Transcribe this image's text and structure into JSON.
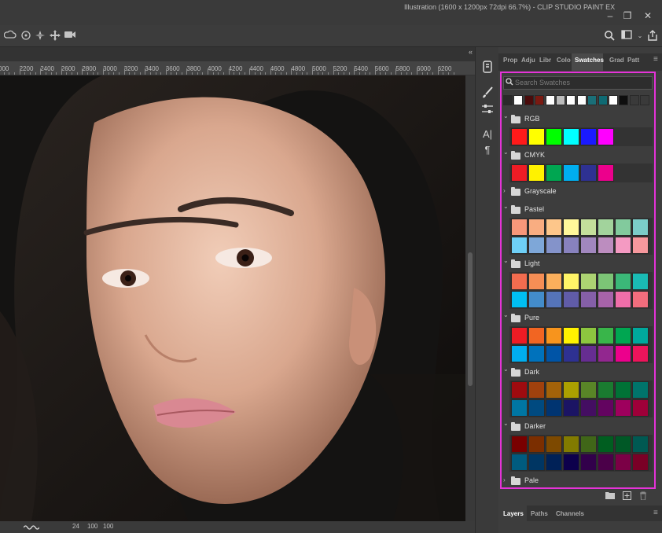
{
  "window": {
    "title": "Illustration (1600 x 1200px 72dpi 66.7%) - CLIP STUDIO PAINT EX",
    "minimize": "–",
    "restore": "❐",
    "close": "✕"
  },
  "ruler": {
    "labels": [
      "000",
      "2200",
      "2400",
      "2600",
      "2800",
      "3000",
      "3200",
      "3400",
      "3600",
      "3800",
      "4000",
      "4200",
      "4400",
      "4600",
      "4800",
      "5000",
      "5200",
      "5400",
      "5600",
      "5800",
      "6000",
      "6200"
    ]
  },
  "status": {
    "brush_size": "24",
    "zoom1": "100",
    "zoom2": "100"
  },
  "panel_tabs": {
    "tabs": [
      "Prop",
      "Adju",
      "Libr",
      "Colo",
      "Swatches",
      "Grad",
      "Patt"
    ],
    "active": "Swatches"
  },
  "swatches": {
    "search_placeholder": "Search Swatches",
    "recent_colors": [
      "#2a2a2a",
      "#ffffff",
      "#4a0b0b",
      "#7a1a12",
      "#ffffff",
      "#bcbcbc",
      "#ffffff",
      "#ffffff",
      "#1a6f78",
      "#0f6a73",
      "#ffffff",
      "#0e0e0e",
      "#3a3a3a",
      "#3a3a3a"
    ],
    "groups": [
      {
        "name": "RGB",
        "expanded": true,
        "rows": [
          [
            "#ff1a1a",
            "#ffff00",
            "#00ff00",
            "#00ffff",
            "#1a1aff",
            "#ff00ff"
          ]
        ]
      },
      {
        "name": "CMYK",
        "expanded": true,
        "rows": [
          [
            "#ee1c25",
            "#fff200",
            "#00a651",
            "#00aeef",
            "#2e3192",
            "#ec008c"
          ]
        ]
      },
      {
        "name": "Grayscale",
        "expanded": false,
        "rows": []
      },
      {
        "name": "Pastel",
        "expanded": true,
        "rows": [
          [
            "#f7977a",
            "#f9ad81",
            "#fdc68a",
            "#fff79a",
            "#c4df9b",
            "#a2d39c",
            "#82ca9d",
            "#7bcdc8"
          ],
          [
            "#6ecff6",
            "#7ea7d8",
            "#8493ca",
            "#8882be",
            "#a187be",
            "#bc8dbf",
            "#f49ac2",
            "#f6989d"
          ]
        ]
      },
      {
        "name": "Light",
        "expanded": true,
        "rows": [
          [
            "#f26c4f",
            "#f68e55",
            "#fbaf5c",
            "#fff467",
            "#acd372",
            "#7cc576",
            "#3bb878",
            "#1abbb4"
          ],
          [
            "#00bff3",
            "#438ccb",
            "#5574b9",
            "#605ca8",
            "#855fa8",
            "#a763a9",
            "#f06ea9",
            "#f26d7d"
          ]
        ]
      },
      {
        "name": "Pure",
        "expanded": true,
        "rows": [
          [
            "#ed1c24",
            "#f26522",
            "#f7941d",
            "#fff200",
            "#8dc63f",
            "#39b54a",
            "#00a651",
            "#00a99d"
          ],
          [
            "#00aeef",
            "#0072bc",
            "#0054a6",
            "#2e3192",
            "#662d91",
            "#92278f",
            "#ec008c",
            "#ed145b"
          ]
        ]
      },
      {
        "name": "Dark",
        "expanded": true,
        "rows": [
          [
            "#9e0b0f",
            "#a0410d",
            "#a36209",
            "#aba000",
            "#598527",
            "#1a7b30",
            "#007236",
            "#00746b"
          ],
          [
            "#0076a3",
            "#004a80",
            "#003471",
            "#1b1464",
            "#440e62",
            "#630460",
            "#9e005d",
            "#9e0039"
          ]
        ]
      },
      {
        "name": "Darker",
        "expanded": true,
        "rows": [
          [
            "#790000",
            "#7b2e00",
            "#7d4900",
            "#827b00",
            "#406618",
            "#005e20",
            "#005826",
            "#005952"
          ],
          [
            "#005b7f",
            "#003663",
            "#002157",
            "#0d004c",
            "#32004b",
            "#4b0049",
            "#7b0046",
            "#7a0026"
          ]
        ]
      },
      {
        "name": "Pale",
        "expanded": false,
        "rows": []
      }
    ]
  },
  "bottom_tabs": {
    "tabs": [
      "Layers",
      "Paths",
      "Channels"
    ],
    "active": "Layers"
  },
  "icons": {
    "toolbar": [
      "cloud-undo-icon",
      "rotate-icon",
      "compass-icon",
      "move-arrows-icon",
      "video-icon"
    ],
    "toolbar_right": [
      "search-icon",
      "layout-icon",
      "share-icon"
    ],
    "toolstrip": [
      "layers-icon",
      "brush-icon",
      "sliders-icon",
      "text-icon",
      "paragraph-icon"
    ]
  }
}
